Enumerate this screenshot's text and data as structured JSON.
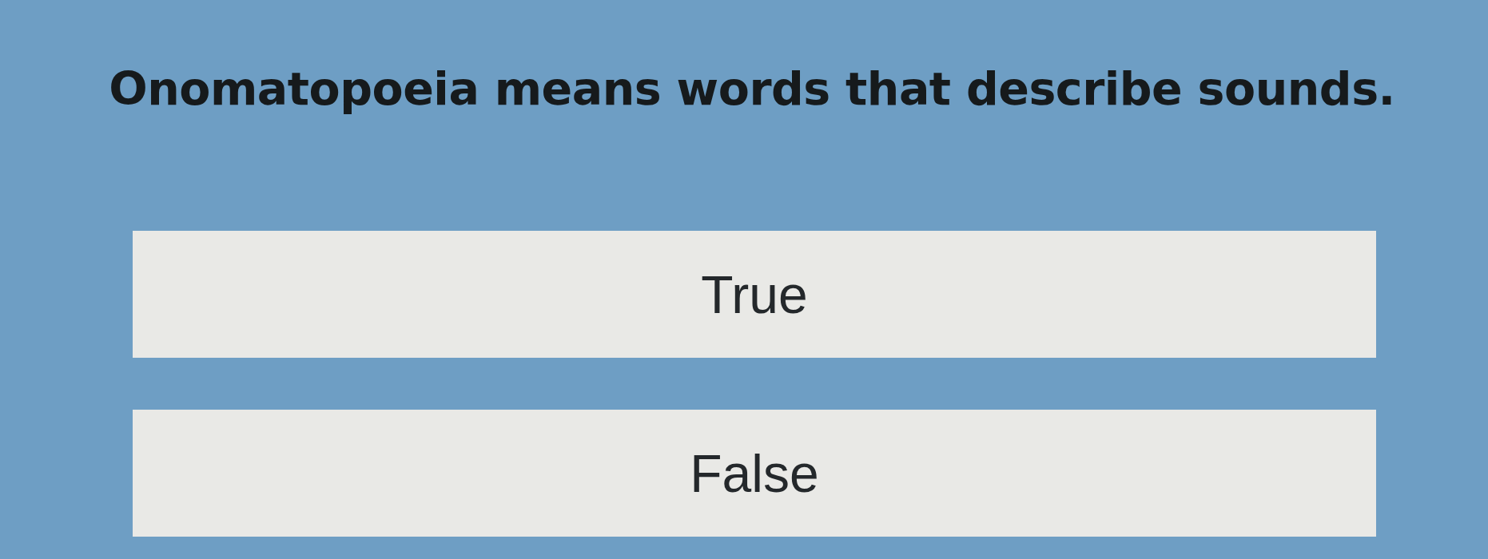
{
  "question": "Onomatopoeia means words that describe sounds.",
  "options": [
    {
      "label": "True"
    },
    {
      "label": "False"
    }
  ]
}
